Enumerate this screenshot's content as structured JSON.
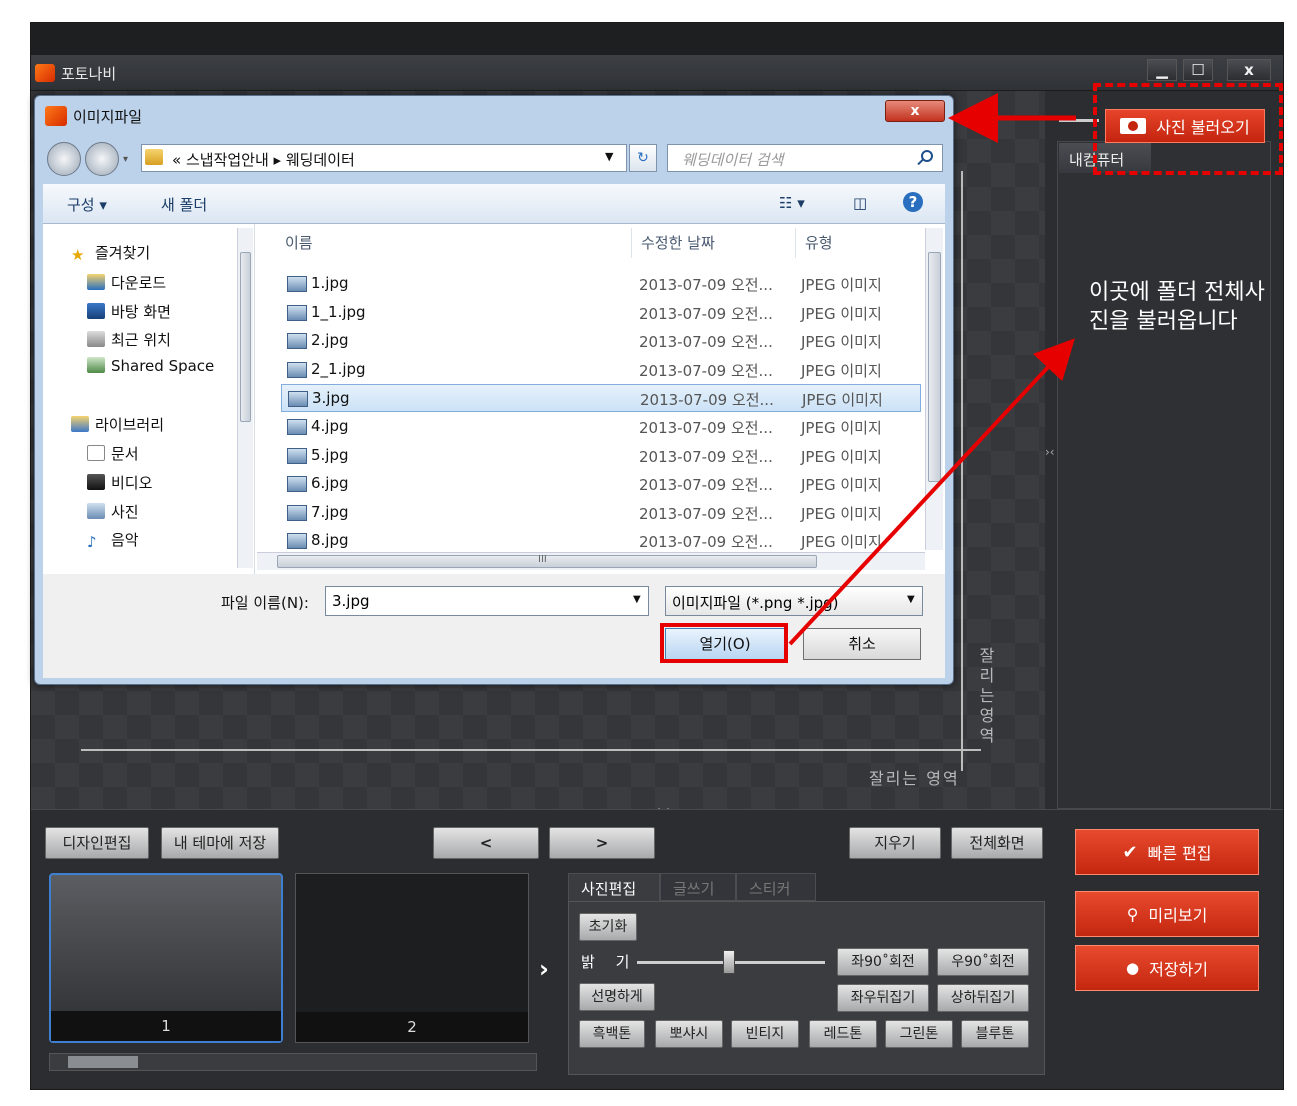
{
  "app": {
    "title": "포토나비",
    "min_label": "▁",
    "max_label": "☐",
    "close_label": "x",
    "crop_text": "잘리는 영역",
    "crop_text_vertical": "잘리는영역"
  },
  "right_panel": {
    "load_button": "사진 불러오기",
    "tab_label": "내컴퓨터",
    "note_text": "이곳에 폴더 전체사진을 불러옵니다"
  },
  "dialog": {
    "title": "이미지파일",
    "close_label": "x",
    "address_prefix": "«",
    "address_path": "스냅작업안내 ▸ 웨딩데이터",
    "search_placeholder": "웨딩데이터 검색",
    "toolbar": {
      "organize": "구성 ▾",
      "new_folder": "새 폴더"
    },
    "nav": {
      "favorites": "즐겨찾기",
      "downloads": "다운로드",
      "desktop": "바탕 화면",
      "recent": "최근 위치",
      "shared": "Shared Space",
      "libraries": "라이브러리",
      "documents": "문서",
      "videos": "비디오",
      "pictures": "사진",
      "music": "음악"
    },
    "columns": {
      "name": "이름",
      "date": "수정한 날짜",
      "type": "유형"
    },
    "files": [
      {
        "name": "1.jpg",
        "date": "2013-07-09 오전...",
        "type": "JPEG 이미지"
      },
      {
        "name": "1_1.jpg",
        "date": "2013-07-09 오전...",
        "type": "JPEG 이미지"
      },
      {
        "name": "2.jpg",
        "date": "2013-07-09 오전...",
        "type": "JPEG 이미지"
      },
      {
        "name": "2_1.jpg",
        "date": "2013-07-09 오전...",
        "type": "JPEG 이미지"
      },
      {
        "name": "3.jpg",
        "date": "2013-07-09 오전...",
        "type": "JPEG 이미지"
      },
      {
        "name": "4.jpg",
        "date": "2013-07-09 오전...",
        "type": "JPEG 이미지"
      },
      {
        "name": "5.jpg",
        "date": "2013-07-09 오전...",
        "type": "JPEG 이미지"
      },
      {
        "name": "6.jpg",
        "date": "2013-07-09 오전...",
        "type": "JPEG 이미지"
      },
      {
        "name": "7.jpg",
        "date": "2013-07-09 오전...",
        "type": "JPEG 이미지"
      },
      {
        "name": "8.jpg",
        "date": "2013-07-09 오전...",
        "type": "JPEG 이미지"
      }
    ],
    "filename_label": "파일 이름(N):",
    "filename_value": "3.jpg",
    "filetype_value": "이미지파일 (*.png *.jpg)",
    "open_button": "열기(O)",
    "cancel_button": "취소",
    "scroll_marker": "III"
  },
  "bottom": {
    "design_edit": "디자인편집",
    "save_theme": "내 테마에 저장",
    "prev": "<",
    "next": ">",
    "erase": "지우기",
    "fullscreen": "전체화면",
    "quick_edit": "빠른 편집",
    "preview": "미리보기",
    "save": "저장하기",
    "thumb1": "1",
    "thumb2": "2",
    "tabs": [
      "사진편집",
      "글쓰기",
      "스티커"
    ],
    "reset": "초기화",
    "brightness": "밝 기",
    "rotate_left": "좌90˚회전",
    "rotate_right": "우90˚회전",
    "sharpen": "선명하게",
    "flip_h": "좌우뒤집기",
    "flip_v": "상하뒤집기",
    "filters": [
      "흑백톤",
      "뽀샤시",
      "빈티지",
      "레드톤",
      "그린톤",
      "블루톤"
    ]
  },
  "colors": {
    "accent_red": "#e60000",
    "button_red": "#d63a1f",
    "selection_blue": "#cce2f7"
  }
}
